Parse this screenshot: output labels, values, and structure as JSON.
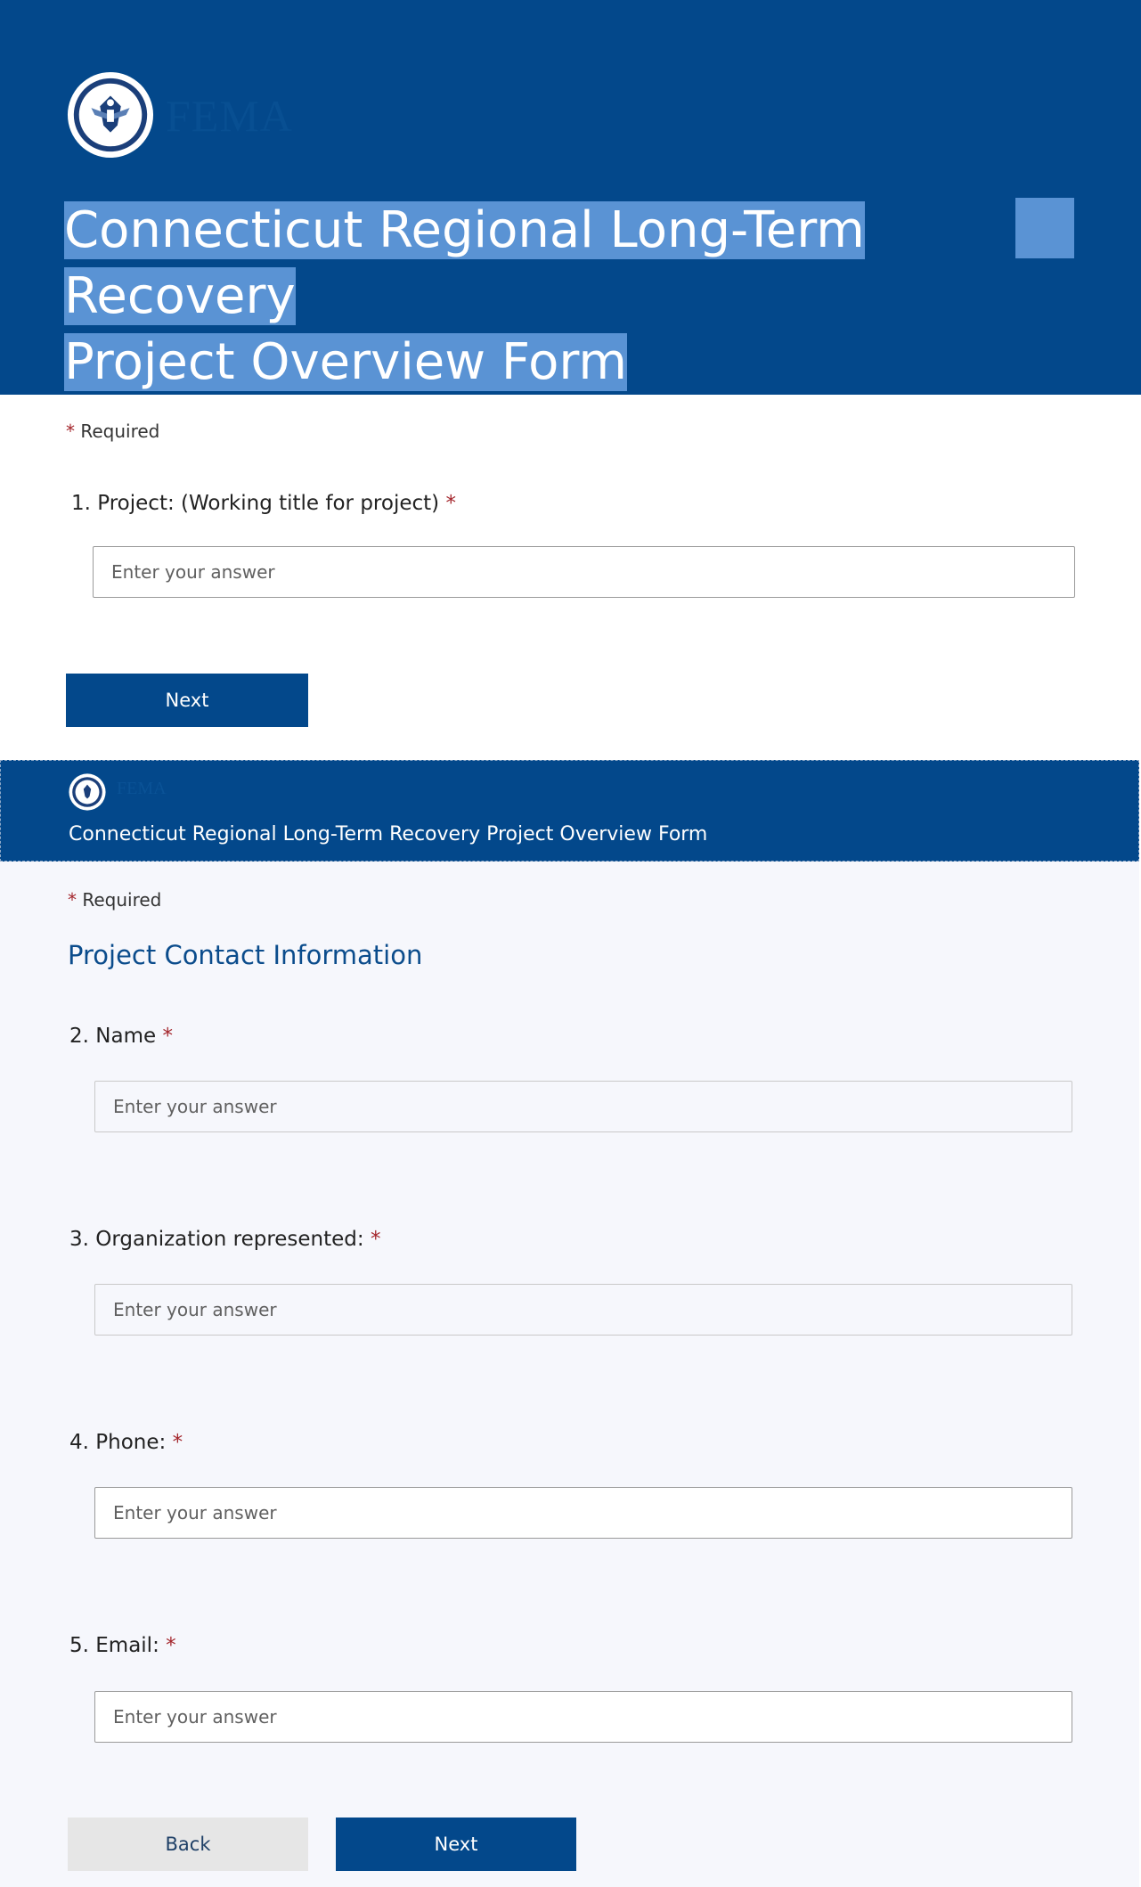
{
  "colors": {
    "header_bg": "#03488b",
    "selection_highlight": "#5a93d4",
    "required_star": "#a4262c",
    "page2_bg": "#f6f7fc",
    "section_heading": "#0b4c8c"
  },
  "page1": {
    "brand": "FEMA",
    "logo_icon": "dhs-seal-icon",
    "title_line1": "Connecticut Regional Long-Term Recovery",
    "title_line2": "Project Overview Form",
    "required_label": "Required",
    "question1": {
      "number": "1.",
      "label": "Project: (Working title for project)",
      "placeholder": "Enter your answer"
    },
    "next_label": "Next"
  },
  "page2": {
    "brand": "FEMA",
    "logo_icon": "dhs-seal-icon",
    "title": "Connecticut Regional Long-Term Recovery Project Overview Form",
    "required_label": "Required",
    "section_heading": "Project Contact Information",
    "questions": [
      {
        "number": "2.",
        "label": "Name",
        "placeholder": "Enter your answer"
      },
      {
        "number": "3.",
        "label": "Organization represented:",
        "placeholder": "Enter your answer"
      },
      {
        "number": "4.",
        "label": "Phone:",
        "placeholder": "Enter your answer"
      },
      {
        "number": "5.",
        "label": "Email:",
        "placeholder": "Enter your answer"
      }
    ],
    "back_label": "Back",
    "next_label": "Next"
  },
  "required_star": "*"
}
